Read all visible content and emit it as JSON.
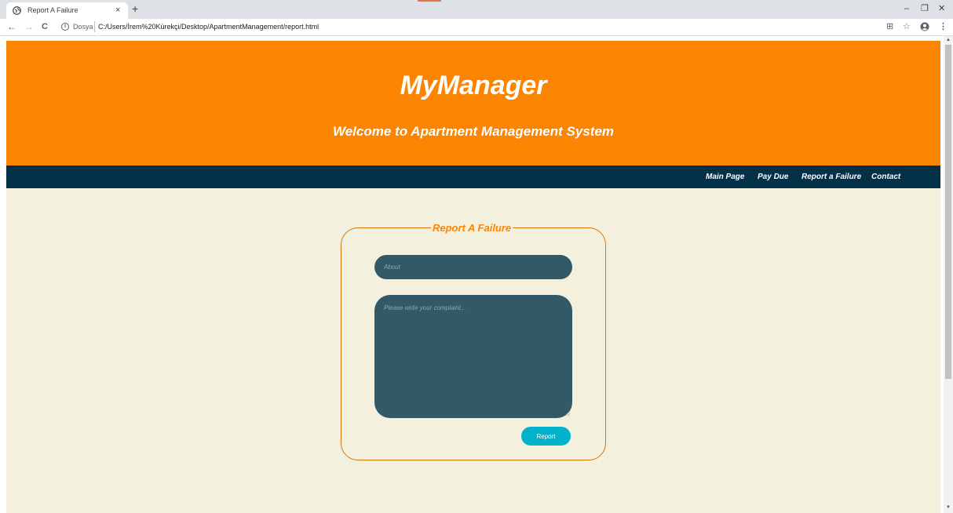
{
  "browser": {
    "tab_title": "Report A Failure",
    "tab_close": "×",
    "new_tab": "+",
    "window_controls": {
      "minimize": "–",
      "restore": "❐",
      "close": "✕"
    },
    "nav": {
      "back": "←",
      "forward": "→",
      "reload": "C"
    },
    "address": {
      "info": "i",
      "scheme_label": "Dosya",
      "url": "C:/Users/İrem%20Kürekçi/Desktop/ApartmentManagement/report.html"
    },
    "toolbar_icons": {
      "translate": "⊞",
      "star": "☆",
      "menu": "⋮"
    }
  },
  "header": {
    "brand": "MyManager",
    "tagline": "Welcome to Apartment Management System"
  },
  "navbar": {
    "items": [
      {
        "label": "Main Page"
      },
      {
        "label": "Pay Due"
      },
      {
        "label": "Report a Failure"
      },
      {
        "label": "Contact"
      }
    ]
  },
  "form": {
    "legend": "Report A Failure",
    "about_placeholder": "About",
    "about_value": "",
    "complaint_placeholder": "Please write your complaint...",
    "complaint_value": "",
    "submit_label": "Report"
  },
  "colors": {
    "header_bg": "#fb8500",
    "navbar_bg": "#023047",
    "page_bg": "#f4f0de",
    "field_bg": "#335966",
    "button_bg": "#00b2ca",
    "border": "#d9740a"
  },
  "scrollbar": {
    "up": "▲",
    "down": "▼"
  }
}
